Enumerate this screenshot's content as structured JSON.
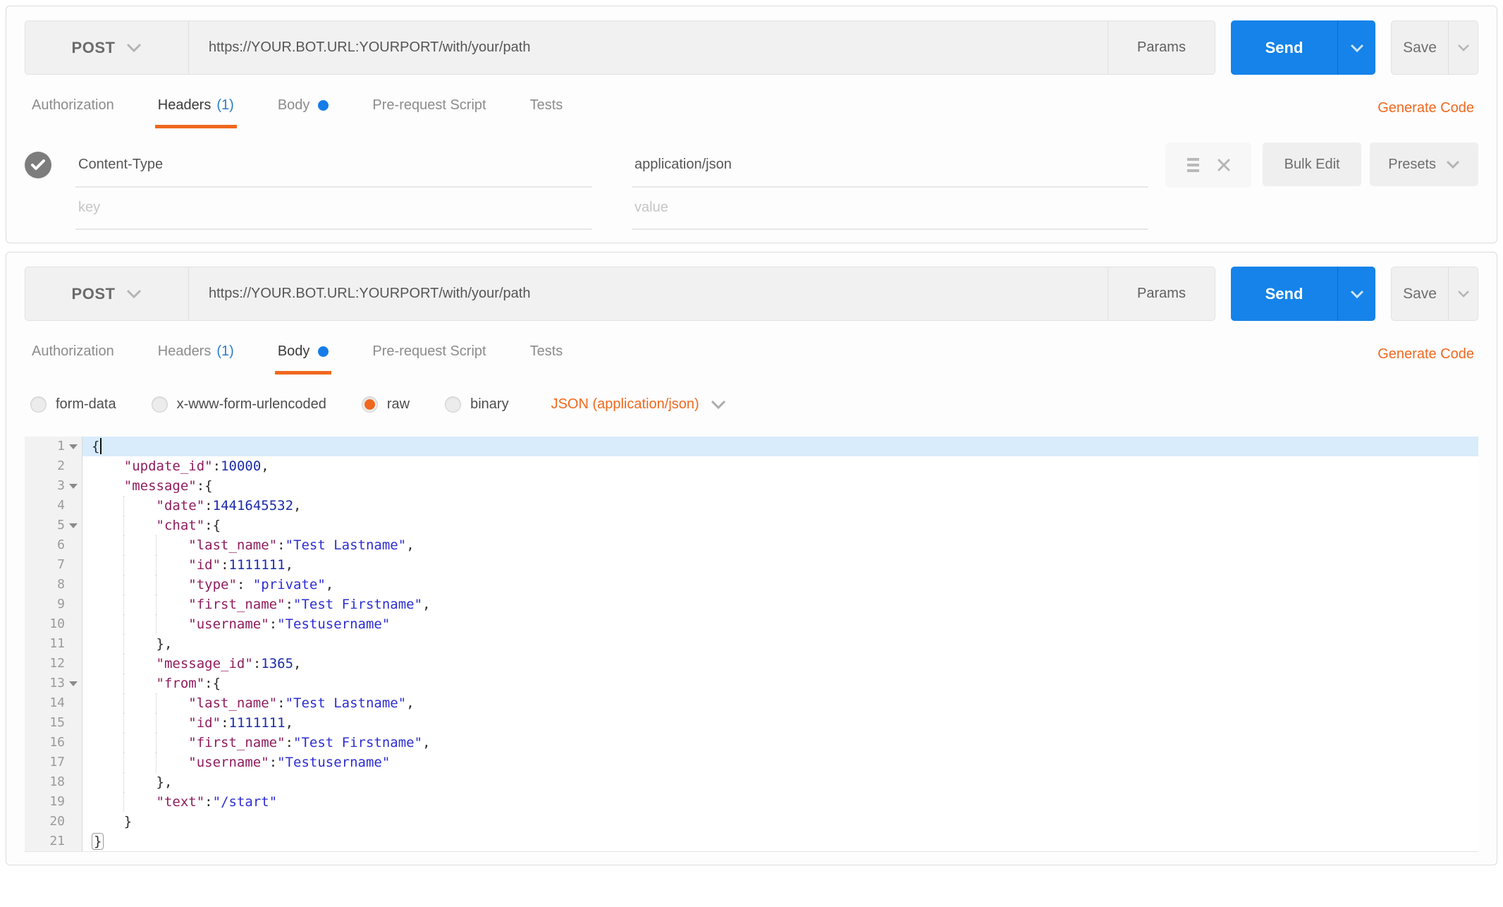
{
  "colors": {
    "accent_orange": "#f0681e",
    "accent_blue": "#1583e9",
    "count_blue": "#2b7cd0"
  },
  "request": {
    "method": "POST",
    "url": "https://YOUR.BOT.URL:YOURPORT/with/your/path",
    "params_label": "Params",
    "send_label": "Send",
    "save_label": "Save",
    "generate_code_label": "Generate Code"
  },
  "panel_headers": {
    "tabs": [
      {
        "label": "Authorization"
      },
      {
        "label": "Headers",
        "count": "(1)",
        "active": true
      },
      {
        "label": "Body",
        "dot": true
      },
      {
        "label": "Pre-request Script"
      },
      {
        "label": "Tests"
      }
    ],
    "header_rows": [
      {
        "key": "Content-Type",
        "value": "application/json",
        "checked": true
      }
    ],
    "key_placeholder": "key",
    "value_placeholder": "value",
    "bulk_edit_label": "Bulk Edit",
    "presets_label": "Presets"
  },
  "panel_body": {
    "tabs": [
      {
        "label": "Authorization"
      },
      {
        "label": "Headers",
        "count": "(1)"
      },
      {
        "label": "Body",
        "dot": true,
        "active": true
      },
      {
        "label": "Pre-request Script"
      },
      {
        "label": "Tests"
      }
    ],
    "body_types": [
      "form-data",
      "x-www-form-urlencoded",
      "raw",
      "binary"
    ],
    "selected_type": "raw",
    "raw_type_label": "JSON (application/json)",
    "editor": {
      "active_line": 1,
      "cursor_line": 1,
      "bracket_match_line": 21,
      "lines": [
        "{",
        "    \"update_id\":10000,",
        "    \"message\":{",
        "        \"date\":1441645532,",
        "        \"chat\":{",
        "            \"last_name\":\"Test Lastname\",",
        "            \"id\":1111111,",
        "            \"type\": \"private\",",
        "            \"first_name\":\"Test Firstname\",",
        "            \"username\":\"Testusername\"",
        "        },",
        "        \"message_id\":1365,",
        "        \"from\":{",
        "            \"last_name\":\"Test Lastname\",",
        "            \"id\":1111111,",
        "            \"first_name\":\"Test Firstname\",",
        "            \"username\":\"Testusername\"",
        "        },",
        "        \"text\":\"/start\"",
        "    }",
        "}"
      ]
    }
  }
}
